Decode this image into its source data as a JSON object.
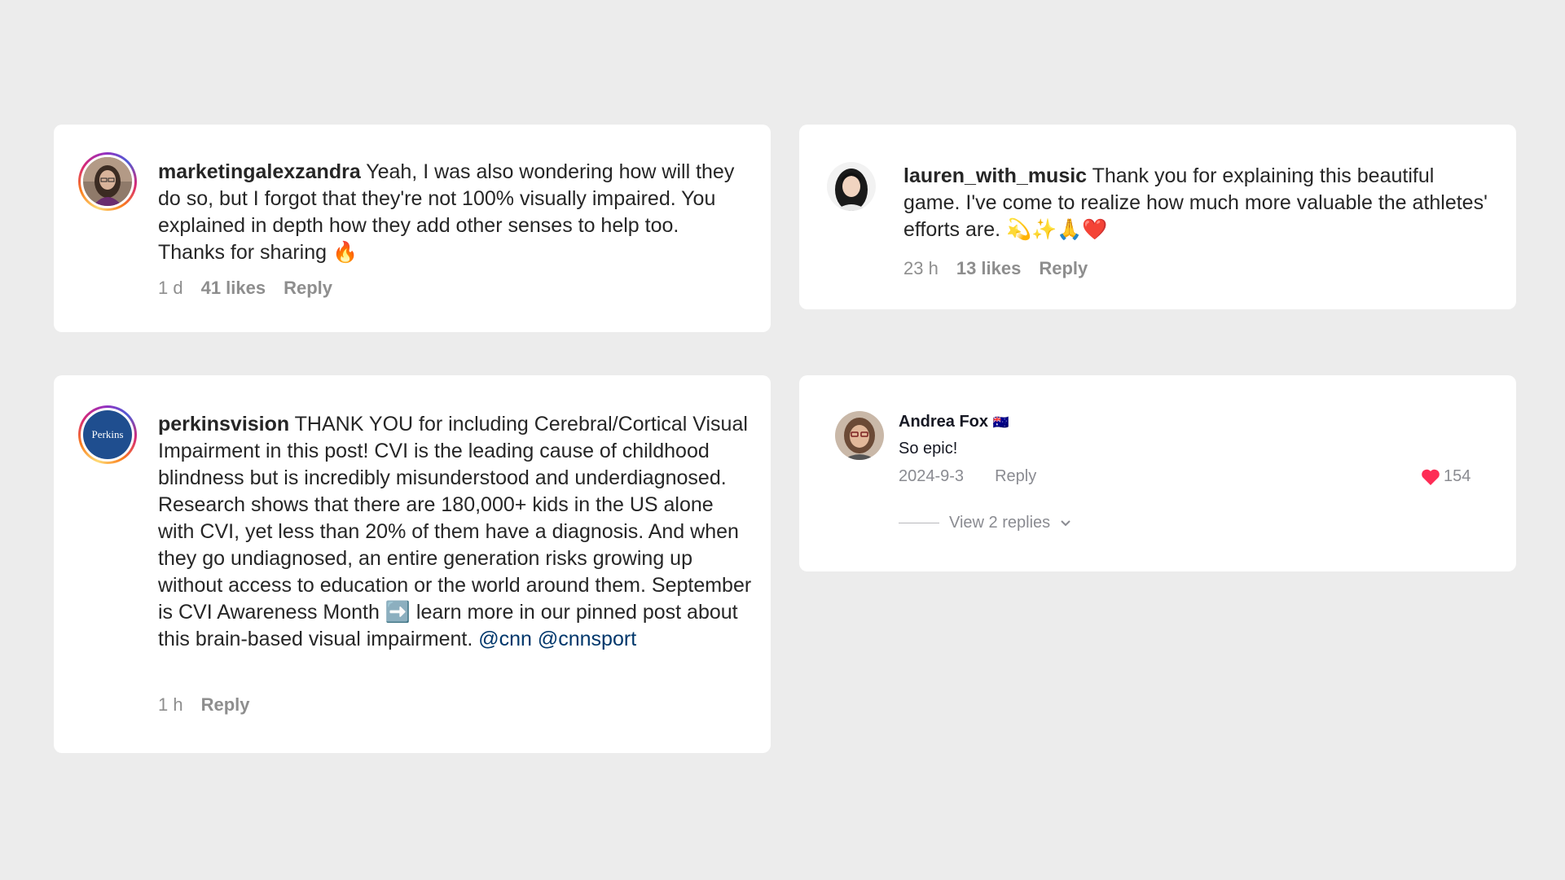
{
  "comments": [
    {
      "username": "marketingalexzandra",
      "text": " Yeah, I was also wondering how will they do so, but I forgot that they're not 100% visually impaired. You explained in depth how they add other senses to help too. Thanks for sharing 🔥",
      "time": "1 d",
      "likes": "41 likes",
      "reply": "Reply"
    },
    {
      "username": "lauren_with_music",
      "text": " Thank you for explaining this beautiful game. I've come to realize how much more valuable the athletes' efforts are. 💫✨🙏❤️",
      "time": "23 h",
      "likes": "13 likes",
      "reply": "Reply"
    },
    {
      "username": "perkinsvision",
      "text": " THANK YOU for including Cerebral/Cortical Visual Impairment in this post! CVI is the leading cause of childhood blindness but is incredibly misunderstood and underdiagnosed. Research shows that there are 180,000+ kids in the US alone with CVI, yet less than 20% of them have a diagnosis. And when they go undiagnosed, an entire generation risks growing up without access to education or the world around them. September is CVI Awareness Month ➡️ learn more in our pinned post about this brain-based visual impairment. ",
      "mentions": [
        "@cnn",
        "@cnnsport"
      ],
      "time": "1 h",
      "reply": "Reply",
      "avatar_label": "Perkins"
    }
  ],
  "tiktok_comment": {
    "name": "Andrea Fox",
    "flag": "🇦🇺",
    "text": "So epic!",
    "date": "2024-9-3",
    "reply": "Reply",
    "like_count": "154",
    "view_replies": "View 2 replies",
    "like_color": "#fe2c55"
  }
}
